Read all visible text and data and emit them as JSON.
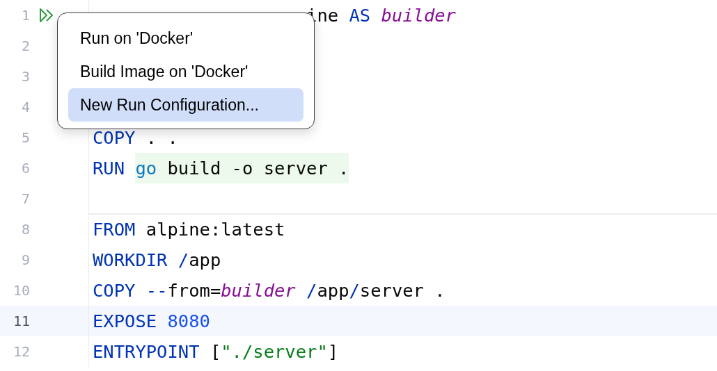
{
  "editor": {
    "lines": [
      {
        "number": "1",
        "run_gutter": true,
        "current": false,
        "separator_after": false,
        "lead_covered": true,
        "tokens": [
          {
            "text": "ine",
            "kind": "plain"
          },
          {
            "text": " AS",
            "kind": "keyword"
          },
          {
            "text": " builder",
            "kind": "alias"
          }
        ]
      },
      {
        "number": "2",
        "run_gutter": false,
        "current": false,
        "separator_after": false
      },
      {
        "number": "3",
        "run_gutter": false,
        "current": false,
        "separator_after": false
      },
      {
        "number": "4",
        "run_gutter": false,
        "current": false,
        "separator_after": false
      },
      {
        "number": "5",
        "run_gutter": false,
        "current": false,
        "separator_after": false,
        "lead_covered": false,
        "tokens": [
          {
            "text": "COPY",
            "kind": "keyword"
          },
          {
            "text": " . .",
            "kind": "plain"
          }
        ]
      },
      {
        "number": "6",
        "run_gutter": false,
        "current": false,
        "separator_after": false,
        "lead_covered": false,
        "tokens": [
          {
            "text": "RUN",
            "kind": "keyword"
          },
          {
            "text": "go",
            "kind": "command",
            "injected": true
          },
          {
            "text": " build -o server .",
            "kind": "plain",
            "injected": true
          }
        ]
      },
      {
        "number": "7",
        "run_gutter": false,
        "current": false,
        "separator_after": true
      },
      {
        "number": "8",
        "run_gutter": false,
        "current": false,
        "separator_after": false,
        "lead_covered": false,
        "tokens": [
          {
            "text": "FROM",
            "kind": "keyword"
          },
          {
            "text": " alpine:latest",
            "kind": "plain"
          }
        ]
      },
      {
        "number": "9",
        "run_gutter": false,
        "current": false,
        "separator_after": false,
        "lead_covered": false,
        "tokens": [
          {
            "text": "WORKDIR",
            "kind": "keyword"
          },
          {
            "text": " /",
            "kind": "punct"
          },
          {
            "text": "app",
            "kind": "plain"
          }
        ]
      },
      {
        "number": "10",
        "run_gutter": false,
        "current": false,
        "separator_after": false,
        "lead_covered": false,
        "tokens": [
          {
            "text": "COPY",
            "kind": "keyword"
          },
          {
            "text": " --",
            "kind": "punct"
          },
          {
            "text": "from=",
            "kind": "plain"
          },
          {
            "text": "builder",
            "kind": "alias"
          },
          {
            "text": " /",
            "kind": "punct"
          },
          {
            "text": "app",
            "kind": "plain"
          },
          {
            "text": "/",
            "kind": "punct"
          },
          {
            "text": "server .",
            "kind": "plain"
          }
        ]
      },
      {
        "number": "11",
        "run_gutter": false,
        "current": true,
        "separator_after": false,
        "lead_covered": false,
        "tokens": [
          {
            "text": "EXPOSE",
            "kind": "keyword"
          },
          {
            "text": " 8080",
            "kind": "number"
          }
        ]
      },
      {
        "number": "12",
        "run_gutter": false,
        "current": false,
        "separator_after": false,
        "lead_covered": false,
        "tokens": [
          {
            "text": "ENTRYPOINT",
            "kind": "keyword"
          },
          {
            "text": " [",
            "kind": "plain"
          },
          {
            "text": "\"./server\"",
            "kind": "string"
          },
          {
            "text": "]",
            "kind": "plain"
          }
        ]
      }
    ]
  },
  "popup_menu": {
    "items": [
      {
        "label": "Run on 'Docker'",
        "selected": false
      },
      {
        "label": "Build Image on 'Docker'",
        "selected": false
      },
      {
        "label": "New Run Configuration...",
        "selected": true
      }
    ]
  }
}
